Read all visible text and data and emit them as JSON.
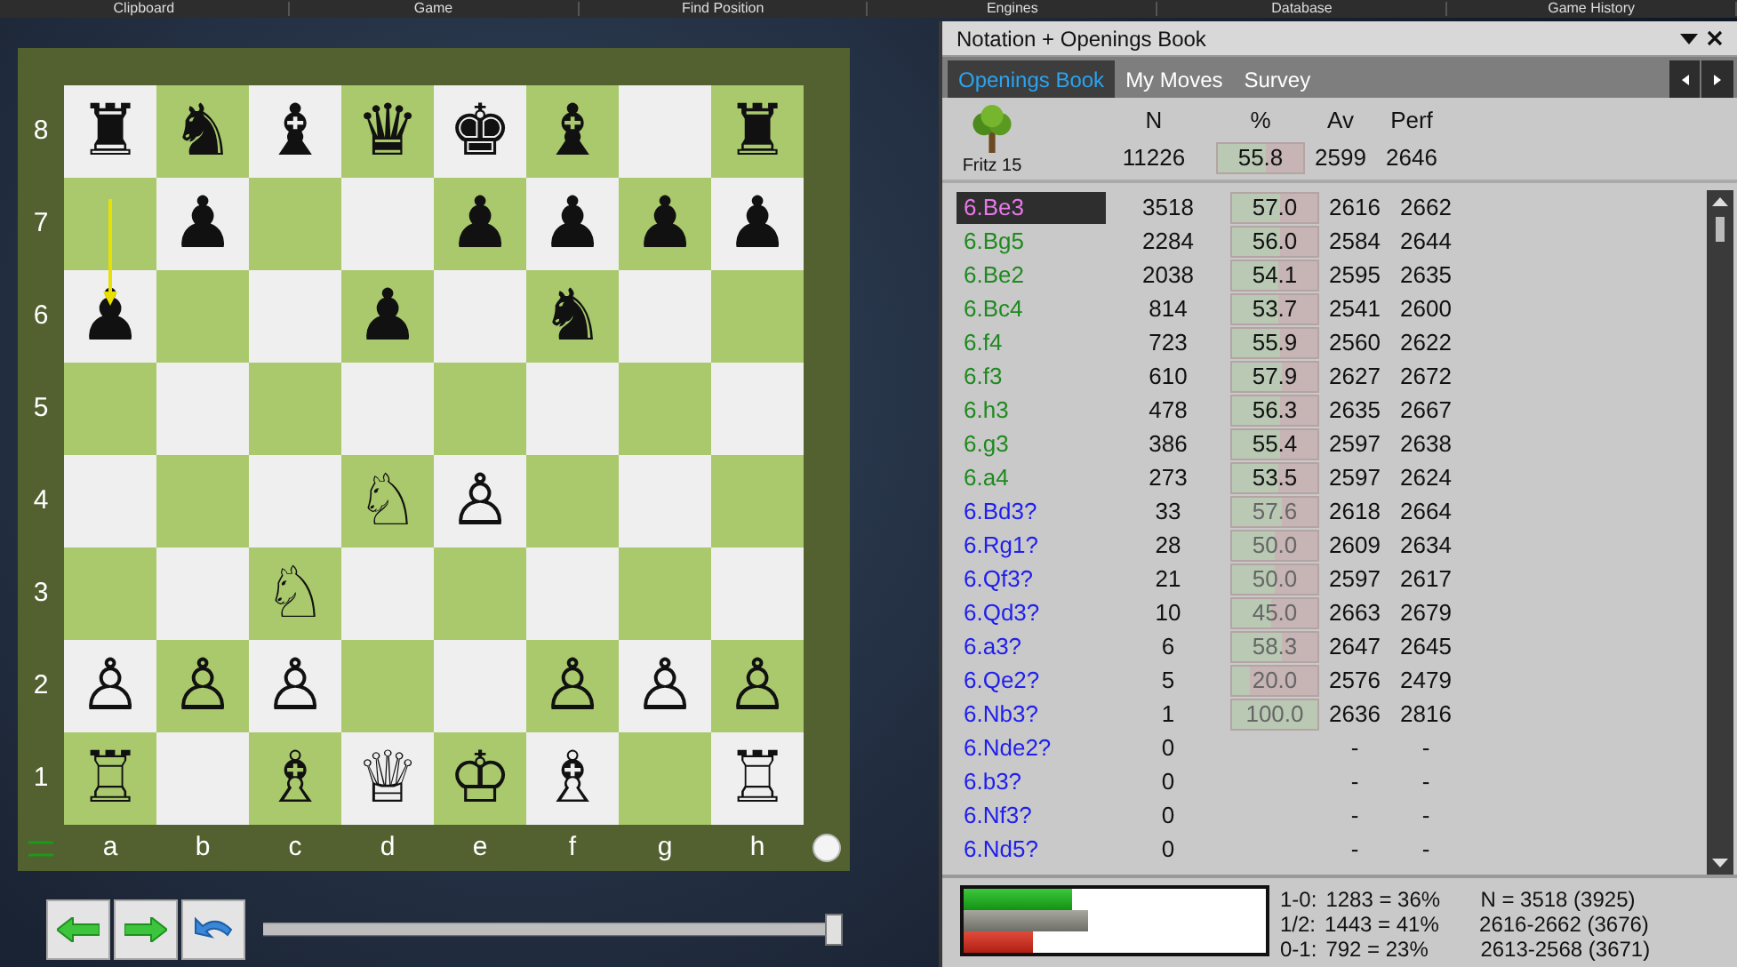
{
  "menu_bar": [
    "Clipboard",
    "Game",
    "Find Position",
    "Engines",
    "Database",
    "Game History"
  ],
  "board": {
    "ranks": [
      {
        "label": "8",
        "squares": [
          {
            "kind": "piece",
            "piece": "♜"
          },
          {
            "kind": "piece",
            "piece": "♞"
          },
          {
            "kind": "piece",
            "piece": "♝"
          },
          {
            "kind": "piece",
            "piece": "♛"
          },
          {
            "kind": "piece",
            "piece": "♚"
          },
          {
            "kind": "piece",
            "piece": "♝"
          },
          {
            "kind": "empty"
          },
          {
            "kind": "piece",
            "piece": "♜"
          }
        ]
      },
      {
        "label": "7",
        "squares": [
          {
            "kind": "empty",
            "arrow_start": true
          },
          {
            "kind": "piece",
            "piece": "♟"
          },
          {
            "kind": "empty"
          },
          {
            "kind": "empty"
          },
          {
            "kind": "piece",
            "piece": "♟"
          },
          {
            "kind": "piece",
            "piece": "♟"
          },
          {
            "kind": "piece",
            "piece": "♟"
          },
          {
            "kind": "piece",
            "piece": "♟"
          }
        ]
      },
      {
        "label": "6",
        "squares": [
          {
            "kind": "piece",
            "piece": "♟",
            "arrow_end": true
          },
          {
            "kind": "empty"
          },
          {
            "kind": "empty"
          },
          {
            "kind": "piece",
            "piece": "♟"
          },
          {
            "kind": "empty"
          },
          {
            "kind": "piece",
            "piece": "♞"
          },
          {
            "kind": "empty"
          },
          {
            "kind": "empty"
          }
        ]
      },
      {
        "label": "5",
        "squares": [
          {
            "kind": "empty"
          },
          {
            "kind": "empty"
          },
          {
            "kind": "empty"
          },
          {
            "kind": "empty"
          },
          {
            "kind": "empty"
          },
          {
            "kind": "empty"
          },
          {
            "kind": "empty"
          },
          {
            "kind": "empty"
          }
        ]
      },
      {
        "label": "4",
        "squares": [
          {
            "kind": "empty"
          },
          {
            "kind": "empty"
          },
          {
            "kind": "empty"
          },
          {
            "kind": "piece",
            "piece": "♘"
          },
          {
            "kind": "piece",
            "piece": "♙"
          },
          {
            "kind": "empty"
          },
          {
            "kind": "empty"
          },
          {
            "kind": "empty"
          }
        ]
      },
      {
        "label": "3",
        "squares": [
          {
            "kind": "empty"
          },
          {
            "kind": "empty"
          },
          {
            "kind": "piece",
            "piece": "♘"
          },
          {
            "kind": "empty"
          },
          {
            "kind": "empty"
          },
          {
            "kind": "empty"
          },
          {
            "kind": "empty"
          },
          {
            "kind": "empty"
          }
        ]
      },
      {
        "label": "2",
        "squares": [
          {
            "kind": "piece",
            "piece": "♙"
          },
          {
            "kind": "piece",
            "piece": "♙"
          },
          {
            "kind": "piece",
            "piece": "♙"
          },
          {
            "kind": "empty"
          },
          {
            "kind": "empty"
          },
          {
            "kind": "piece",
            "piece": "♙"
          },
          {
            "kind": "piece",
            "piece": "♙"
          },
          {
            "kind": "piece",
            "piece": "♙"
          }
        ]
      },
      {
        "label": "1",
        "squares": [
          {
            "kind": "piece",
            "piece": "♖"
          },
          {
            "kind": "empty"
          },
          {
            "kind": "piece",
            "piece": "♗"
          },
          {
            "kind": "piece",
            "piece": "♕"
          },
          {
            "kind": "piece",
            "piece": "♔"
          },
          {
            "kind": "piece",
            "piece": "♗"
          },
          {
            "kind": "empty"
          },
          {
            "kind": "piece",
            "piece": "♖"
          }
        ]
      }
    ],
    "files": [
      "a",
      "b",
      "c",
      "d",
      "e",
      "f",
      "g",
      "h"
    ],
    "white_to_move": true
  },
  "move_slider": {
    "level": 1
  },
  "panel": {
    "title": "Notation + Openings Book",
    "tabs": [
      {
        "label": "Openings Book",
        "selected": true
      },
      {
        "label": "My Moves",
        "selected": false
      },
      {
        "label": "Survey",
        "selected": false
      }
    ],
    "book_name": "Fritz 15",
    "columns": [
      "N",
      "%",
      "Av",
      "Perf"
    ],
    "totals": {
      "n": "11226",
      "pct": "55.8",
      "level": 0.558,
      "av": "2599",
      "perf": "2646"
    },
    "moves": [
      {
        "move": "6.Be3",
        "kind": "main",
        "selected": true,
        "n": "3518",
        "pct": "57.0",
        "level": 0.57,
        "dim": false,
        "av": "2616",
        "perf": "2662"
      },
      {
        "move": "6.Bg5",
        "kind": "main",
        "selected": false,
        "n": "2284",
        "pct": "56.0",
        "level": 0.56,
        "dim": false,
        "av": "2584",
        "perf": "2644"
      },
      {
        "move": "6.Be2",
        "kind": "main",
        "selected": false,
        "n": "2038",
        "pct": "54.1",
        "level": 0.541,
        "dim": false,
        "av": "2595",
        "perf": "2635"
      },
      {
        "move": "6.Bc4",
        "kind": "main",
        "selected": false,
        "n": "814",
        "pct": "53.7",
        "level": 0.537,
        "dim": false,
        "av": "2541",
        "perf": "2600"
      },
      {
        "move": "6.f4",
        "kind": "main",
        "selected": false,
        "n": "723",
        "pct": "55.9",
        "level": 0.559,
        "dim": false,
        "av": "2560",
        "perf": "2622"
      },
      {
        "move": "6.f3",
        "kind": "main",
        "selected": false,
        "n": "610",
        "pct": "57.9",
        "level": 0.579,
        "dim": false,
        "av": "2627",
        "perf": "2672"
      },
      {
        "move": "6.h3",
        "kind": "main",
        "selected": false,
        "n": "478",
        "pct": "56.3",
        "level": 0.563,
        "dim": false,
        "av": "2635",
        "perf": "2667"
      },
      {
        "move": "6.g3",
        "kind": "main",
        "selected": false,
        "n": "386",
        "pct": "55.4",
        "level": 0.554,
        "dim": false,
        "av": "2597",
        "perf": "2638"
      },
      {
        "move": "6.a4",
        "kind": "main",
        "selected": false,
        "n": "273",
        "pct": "53.5",
        "level": 0.535,
        "dim": false,
        "av": "2597",
        "perf": "2624"
      },
      {
        "move": "6.Bd3?",
        "kind": "rare",
        "selected": false,
        "n": "33",
        "pct": "57.6",
        "level": 0.576,
        "dim": true,
        "av": "2618",
        "perf": "2664"
      },
      {
        "move": "6.Rg1?",
        "kind": "rare",
        "selected": false,
        "n": "28",
        "pct": "50.0",
        "level": 0.5,
        "dim": true,
        "av": "2609",
        "perf": "2634"
      },
      {
        "move": "6.Qf3?",
        "kind": "rare",
        "selected": false,
        "n": "21",
        "pct": "50.0",
        "level": 0.5,
        "dim": true,
        "av": "2597",
        "perf": "2617"
      },
      {
        "move": "6.Qd3?",
        "kind": "rare",
        "selected": false,
        "n": "10",
        "pct": "45.0",
        "level": 0.45,
        "dim": true,
        "av": "2663",
        "perf": "2679"
      },
      {
        "move": "6.a3?",
        "kind": "rare",
        "selected": false,
        "n": "6",
        "pct": "58.3",
        "level": 0.583,
        "dim": true,
        "av": "2647",
        "perf": "2645"
      },
      {
        "move": "6.Qe2?",
        "kind": "rare",
        "selected": false,
        "n": "5",
        "pct": "20.0",
        "level": 0.2,
        "dim": true,
        "av": "2576",
        "perf": "2479"
      },
      {
        "move": "6.Nb3?",
        "kind": "rare",
        "selected": false,
        "n": "1",
        "pct": "100.0",
        "level": 1,
        "dim": true,
        "av": "2636",
        "perf": "2816"
      },
      {
        "move": "6.Nde2?",
        "kind": "rare",
        "selected": false,
        "n": "0",
        "av": "-",
        "perf": "-"
      },
      {
        "move": "6.b3?",
        "kind": "rare",
        "selected": false,
        "n": "0",
        "av": "-",
        "perf": "-"
      },
      {
        "move": "6.Nf3?",
        "kind": "rare",
        "selected": false,
        "n": "0",
        "av": "-",
        "perf": "-"
      },
      {
        "move": "6.Nd5?",
        "kind": "rare",
        "selected": false,
        "n": "0",
        "av": "-",
        "perf": "-"
      }
    ],
    "results": [
      {
        "kind": "win",
        "label": "1-0:",
        "text": "1283 = 36%",
        "level": 0.36,
        "info": "N = 3518 (3925)"
      },
      {
        "kind": "draw",
        "label": "1/2:",
        "text": "1443 = 41%",
        "level": 0.41,
        "info": "2616-2662 (3676)"
      },
      {
        "kind": "loss",
        "label": "0-1:",
        "text": "792 = 23%",
        "level": 0.23,
        "info": "2613-2568 (3671)"
      }
    ]
  }
}
